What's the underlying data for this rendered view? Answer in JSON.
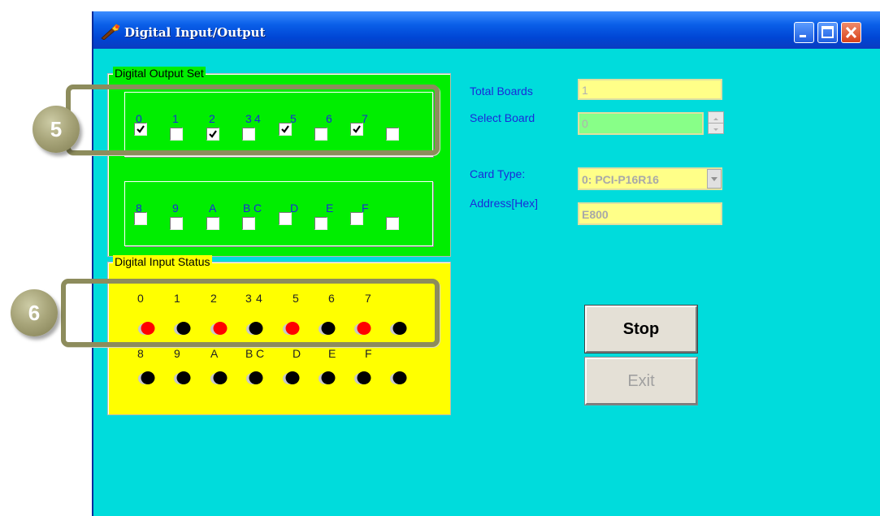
{
  "window": {
    "title": "Digital Input/Output",
    "icon": "torch-icon",
    "controls": [
      "minimize-icon",
      "maximize-icon",
      "close-icon"
    ]
  },
  "digital_output": {
    "legend": "Digital Output Set",
    "row1": {
      "labels": [
        "0",
        "1",
        "2",
        "3",
        "4",
        "5",
        "6",
        "7"
      ],
      "checked": [
        true,
        false,
        true,
        false,
        true,
        false,
        true,
        false
      ]
    },
    "row2": {
      "labels": [
        "8",
        "9",
        "A",
        "B",
        "C",
        "D",
        "E",
        "F"
      ],
      "checked": [
        false,
        false,
        false,
        false,
        false,
        false,
        false,
        false
      ]
    }
  },
  "digital_input": {
    "legend": "Digital Input Status",
    "row1": {
      "labels": [
        "0",
        "1",
        "2",
        "3",
        "4",
        "5",
        "6",
        "7"
      ],
      "on": [
        true,
        false,
        true,
        false,
        true,
        false,
        true,
        false
      ]
    },
    "row2": {
      "labels": [
        "8",
        "9",
        "A",
        "B",
        "C",
        "D",
        "E",
        "F"
      ],
      "on": [
        false,
        false,
        false,
        false,
        false,
        false,
        false,
        false
      ]
    }
  },
  "info": {
    "total_boards_label": "Total Boards",
    "total_boards_value": "1",
    "select_board_label": "Select Board",
    "select_board_value": "0",
    "card_type_label": "Card Type:",
    "card_type_value": "0: PCI-P16R16",
    "address_label": "Address[Hex]",
    "address_value": "E800"
  },
  "buttons": {
    "stop": "Stop",
    "exit": "Exit"
  },
  "callouts": [
    "5",
    "6"
  ],
  "colors": {
    "client_bg": "#00dcdc",
    "output_bg": "#00ee00",
    "input_bg": "#ffff00",
    "led_on": "#ff0000",
    "led_off": "#000000",
    "label_blue": "#1a2ad8",
    "callout": "#8d8c5c"
  }
}
